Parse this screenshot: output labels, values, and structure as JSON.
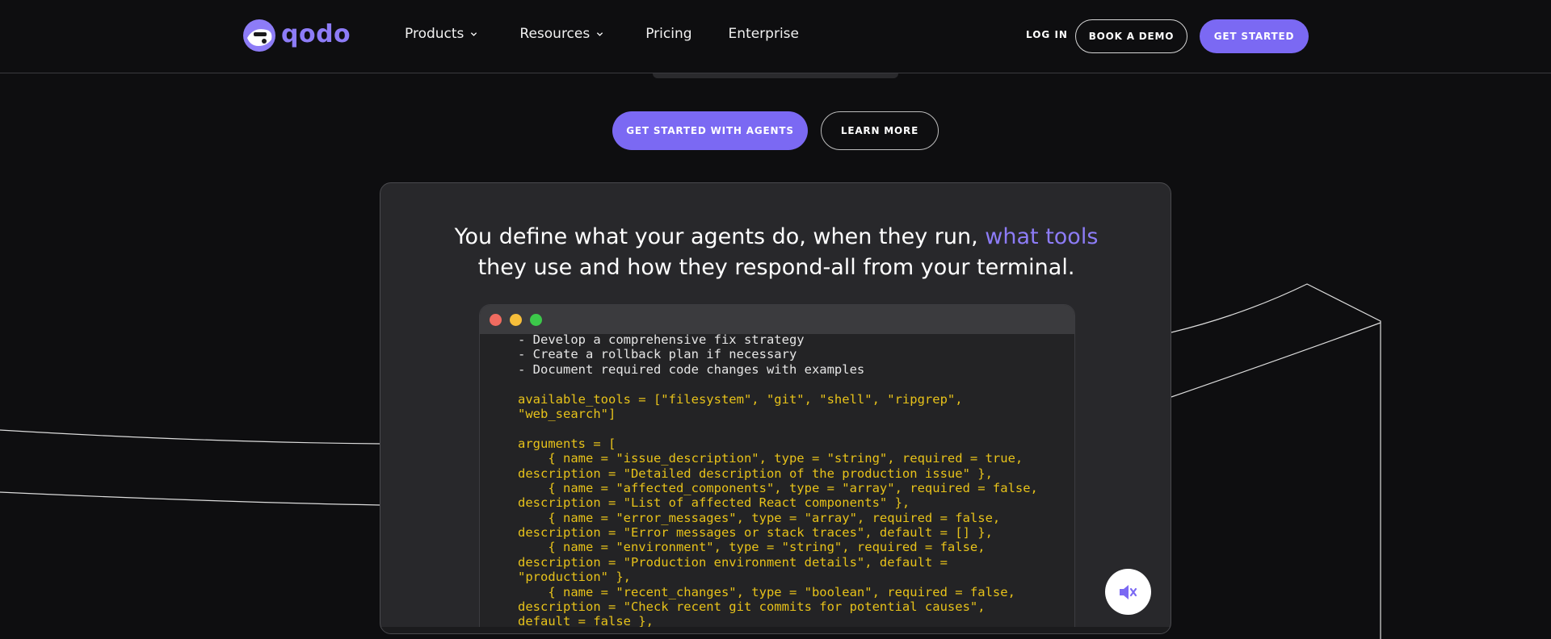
{
  "header": {
    "logo_text": "qodo",
    "nav": [
      {
        "label": "Products",
        "has_dropdown": true
      },
      {
        "label": "Resources",
        "has_dropdown": true
      },
      {
        "label": "Pricing",
        "has_dropdown": false
      },
      {
        "label": "Enterprise",
        "has_dropdown": false
      }
    ],
    "login_label": "LOG IN",
    "book_demo_label": "BOOK A DEMO",
    "get_started_label": "GET STARTED"
  },
  "hero": {
    "primary_cta": "GET STARTED WITH AGENTS",
    "secondary_cta": "LEARN MORE"
  },
  "card": {
    "headline_part1": "You define what your agents do, when they run, ",
    "headline_highlight": "what tools",
    "headline_part2": "they use and how they respond-all from your terminal."
  },
  "terminal": {
    "lines": [
      {
        "text": "- Develop a comprehensive fix strategy",
        "color": "white"
      },
      {
        "text": "- Create a rollback plan if necessary",
        "color": "white"
      },
      {
        "text": "- Document required code changes with examples",
        "color": "white"
      },
      {
        "text": "",
        "color": "white"
      },
      {
        "text": "available_tools = [\"filesystem\", \"git\", \"shell\", \"ripgrep\",",
        "color": "yellow"
      },
      {
        "text": "\"web_search\"]",
        "color": "yellow"
      },
      {
        "text": "",
        "color": "yellow"
      },
      {
        "text": "arguments = [",
        "color": "yellow"
      },
      {
        "text": "    { name = \"issue_description\", type = \"string\", required = true,",
        "color": "yellow"
      },
      {
        "text": "description = \"Detailed description of the production issue\" },",
        "color": "yellow"
      },
      {
        "text": "    { name = \"affected_components\", type = \"array\", required = false,",
        "color": "yellow"
      },
      {
        "text": "description = \"List of affected React components\" },",
        "color": "yellow"
      },
      {
        "text": "    { name = \"error_messages\", type = \"array\", required = false,",
        "color": "yellow"
      },
      {
        "text": "description = \"Error messages or stack traces\", default = [] },",
        "color": "yellow"
      },
      {
        "text": "    { name = \"environment\", type = \"string\", required = false,",
        "color": "yellow"
      },
      {
        "text": "description = \"Production environment details\", default =",
        "color": "yellow"
      },
      {
        "text": "\"production\" },",
        "color": "yellow"
      },
      {
        "text": "    { name = \"recent_changes\", type = \"boolean\", required = false,",
        "color": "yellow"
      },
      {
        "text": "description = \"Check recent git commits for potential causes\",",
        "color": "yellow"
      },
      {
        "text": "default = false },",
        "color": "yellow"
      }
    ]
  },
  "controls": {
    "mute_icon": "speaker-muted-icon"
  },
  "colors": {
    "accent": "#7b69f3",
    "background": "#0e0e10",
    "card": "#28282b",
    "code_yellow": "#e7c21a"
  }
}
